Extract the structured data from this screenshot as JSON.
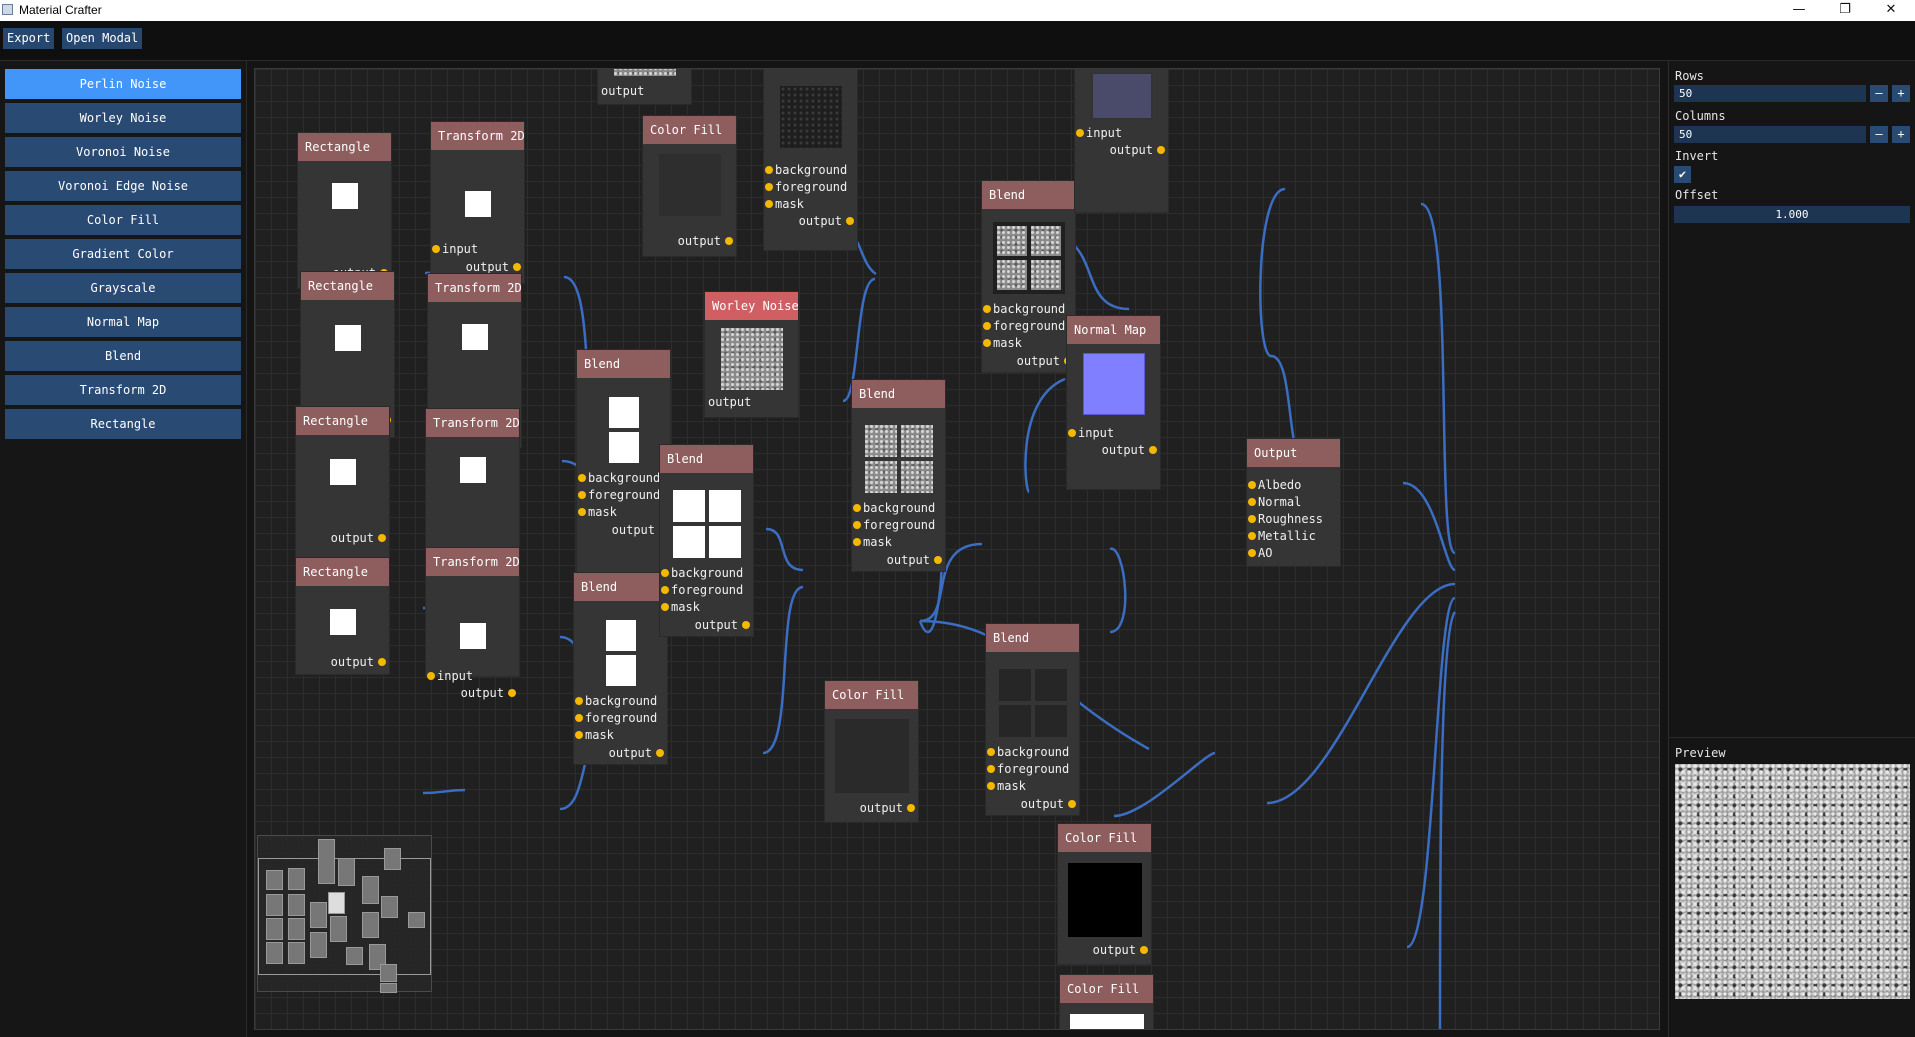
{
  "window": {
    "title": "Material Crafter",
    "minimize": "—",
    "maximize": "❐",
    "close": "✕"
  },
  "menu": {
    "export": "Export",
    "open_modal": "Open Modal"
  },
  "palette": [
    "Perlin Noise",
    "Worley Noise",
    "Voronoi Noise",
    "Voronoi Edge Noise",
    "Color Fill",
    "Gradient Color",
    "Grayscale",
    "Normal Map",
    "Blend",
    "Transform 2D",
    "Rectangle"
  ],
  "palette_active": "Perlin Noise",
  "ports": {
    "output": "output",
    "input": "input",
    "background": "background",
    "foreground": "foreground",
    "mask": "mask"
  },
  "nodes": {
    "rect1": "Rectangle",
    "rect2": "Rectangle",
    "rect3": "Rectangle",
    "rect4": "Rectangle",
    "tr1": "Transform 2D",
    "tr2": "Transform 2D",
    "tr3": "Transform 2D",
    "tr4": "Transform 2D",
    "blendA": "Blend",
    "blendB": "Blend",
    "blendC": "Blend",
    "blendD": "Blend",
    "blendE": "Blend",
    "blendF": "Blend",
    "worley": "Worley Noise",
    "colorfill1": "Color Fill",
    "colorfill2": "Color Fill",
    "colorfill3": "Color Fill",
    "colorfill4": "Color Fill",
    "normalmap": "Normal Map",
    "output": "Output"
  },
  "output_ports": [
    "Albedo",
    "Normal",
    "Roughness",
    "Metallic",
    "AO"
  ],
  "properties": {
    "rows_label": "Rows",
    "rows_value": "50",
    "columns_label": "Columns",
    "columns_value": "50",
    "invert_label": "Invert",
    "invert_checked": true,
    "check_glyph": "✔",
    "offset_label": "Offset",
    "offset_value": "1.000",
    "minus": "–",
    "plus": "+",
    "preview_label": "Preview"
  },
  "colors": {
    "accent": "#4296fa",
    "button": "#294a73",
    "node_header": "#8e5d5d",
    "node_header_selected": "#cf5f63",
    "wire": "#3b6ec2",
    "port": "#f5b800"
  }
}
